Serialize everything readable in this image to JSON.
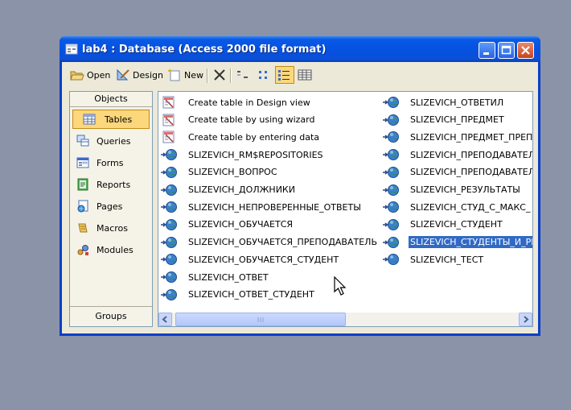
{
  "window": {
    "title": "lab4 : Database (Access 2000 file format)"
  },
  "toolbar": {
    "open_label": "Open",
    "design_label": "Design",
    "new_label": "New"
  },
  "sidebar": {
    "header": "Objects",
    "footer": "Groups",
    "items": [
      {
        "label": "Tables",
        "icon": "table-icon",
        "active": true
      },
      {
        "label": "Queries",
        "icon": "query-icon"
      },
      {
        "label": "Forms",
        "icon": "form-icon"
      },
      {
        "label": "Reports",
        "icon": "report-icon"
      },
      {
        "label": "Pages",
        "icon": "page-icon"
      },
      {
        "label": "Macros",
        "icon": "macro-icon"
      },
      {
        "label": "Modules",
        "icon": "module-icon"
      }
    ]
  },
  "tables": {
    "column1": [
      {
        "label": "Create table in Design view",
        "icon": "create-table-icon"
      },
      {
        "label": "Create table by using wizard",
        "icon": "create-table-icon"
      },
      {
        "label": "Create table by entering data",
        "icon": "create-table-icon"
      },
      {
        "label": "SLIZEVICH_RM$REPOSITORIES",
        "icon": "linked-table-icon"
      },
      {
        "label": "SLIZEVICH_ВОПРОС",
        "icon": "linked-table-icon"
      },
      {
        "label": "SLIZEVICH_ДОЛЖНИКИ",
        "icon": "linked-table-icon"
      },
      {
        "label": "SLIZEVICH_НЕПРОВЕРЕННЫЕ_ОТВЕТЫ",
        "icon": "linked-table-icon"
      },
      {
        "label": "SLIZEVICH_ОБУЧАЕТСЯ",
        "icon": "linked-table-icon"
      },
      {
        "label": "SLIZEVICH_ОБУЧАЕТСЯ_ПРЕПОДАВАТЕЛЬ",
        "icon": "linked-table-icon"
      },
      {
        "label": "SLIZEVICH_ОБУЧАЕТСЯ_СТУДЕНТ",
        "icon": "linked-table-icon"
      },
      {
        "label": "SLIZEVICH_ОТВЕТ",
        "icon": "linked-table-icon"
      },
      {
        "label": "SLIZEVICH_ОТВЕТ_СТУДЕНТ",
        "icon": "linked-table-icon"
      }
    ],
    "column2": [
      {
        "label": "SLIZEVICH_ОТВЕТИЛ",
        "icon": "linked-table-icon"
      },
      {
        "label": "SLIZEVICH_ПРЕДМЕТ",
        "icon": "linked-table-icon"
      },
      {
        "label": "SLIZEVICH_ПРЕДМЕТ_ПРЕПО",
        "icon": "linked-table-icon"
      },
      {
        "label": "SLIZEVICH_ПРЕПОДАВАТЕЛІ",
        "icon": "linked-table-icon"
      },
      {
        "label": "SLIZEVICH_ПРЕПОДАВАТЕЛІ",
        "icon": "linked-table-icon"
      },
      {
        "label": "SLIZEVICH_РЕЗУЛЬТАТЫ",
        "icon": "linked-table-icon"
      },
      {
        "label": "SLIZEVICH_СТУД_С_МАКС_",
        "icon": "linked-table-icon"
      },
      {
        "label": "SLIZEVICH_СТУДЕНТ",
        "icon": "linked-table-icon"
      },
      {
        "label": "SLIZEVICH_СТУДЕНТЫ_И_РІ",
        "icon": "linked-table-icon",
        "selected": true
      },
      {
        "label": "SLIZEVICH_ТЕСТ",
        "icon": "linked-table-icon"
      }
    ]
  },
  "colors": {
    "desktop": "#8b93a8",
    "title_bar": "#0551e0",
    "selection": "#316ac5",
    "active_object": "#fcd77c"
  }
}
